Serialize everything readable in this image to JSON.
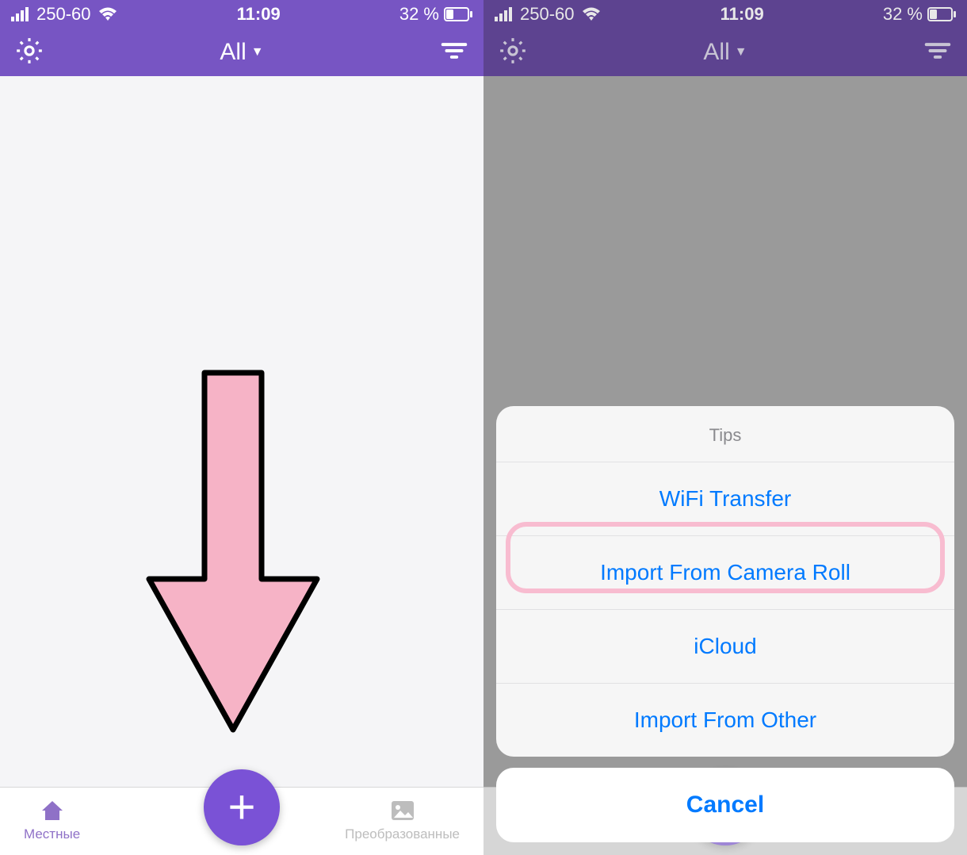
{
  "status": {
    "carrier": "250-60",
    "time": "11:09",
    "battery": "32 %"
  },
  "nav": {
    "title": "All"
  },
  "tabs": {
    "local": "Местные",
    "converted": "Преобразованные"
  },
  "sheet": {
    "title": "Tips",
    "items": [
      "WiFi Transfer",
      "Import From Camera Roll",
      "iCloud",
      "Import From Other"
    ],
    "cancel": "Cancel"
  }
}
